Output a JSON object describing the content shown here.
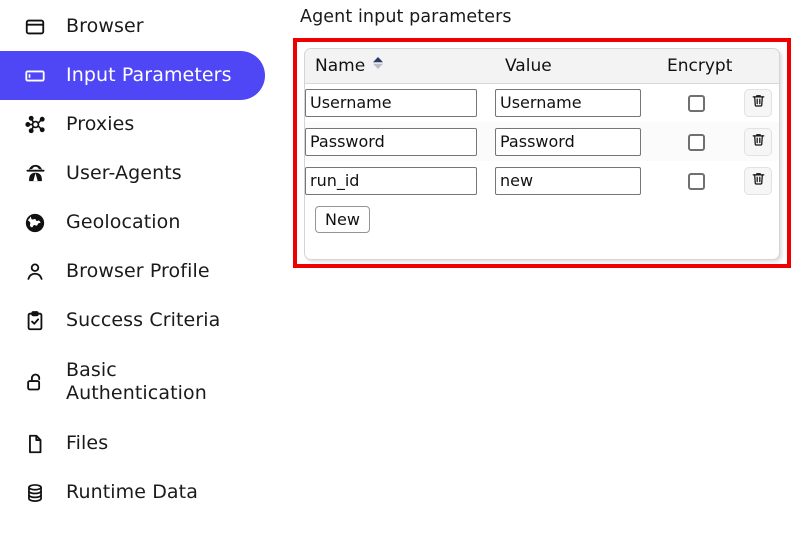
{
  "sidebar": {
    "items": [
      {
        "label": "Browser",
        "icon": "browser-window-icon",
        "active": false
      },
      {
        "label": "Input Parameters",
        "icon": "input-field-icon",
        "active": true
      },
      {
        "label": "Proxies",
        "icon": "network-nodes-icon",
        "active": false
      },
      {
        "label": "User-Agents",
        "icon": "spy-agent-icon",
        "active": false
      },
      {
        "label": "Geolocation",
        "icon": "globe-icon",
        "active": false
      },
      {
        "label": "Browser Profile",
        "icon": "user-profile-icon",
        "active": false
      },
      {
        "label": "Success Criteria",
        "icon": "clipboard-check-icon",
        "active": false
      },
      {
        "label": "Basic\nAuthentication",
        "icon": "unlocked-padlock-icon",
        "active": false
      },
      {
        "label": "Files",
        "icon": "document-icon",
        "active": false
      },
      {
        "label": "Runtime Data",
        "icon": "database-icon",
        "active": false
      }
    ],
    "active_color": "#4f46f5",
    "active_text_color": "#ffffff"
  },
  "main": {
    "title": "Agent input parameters",
    "highlight_color": "#ee0000",
    "table": {
      "columns": [
        {
          "key": "name",
          "label": "Name",
          "sortable": true,
          "sort_icon": "sort-updown-icon",
          "sort_direction": "asc"
        },
        {
          "key": "value",
          "label": "Value",
          "sortable": false
        },
        {
          "key": "encrypt",
          "label": "Encrypt",
          "sortable": false
        },
        {
          "key": "delete",
          "label": "",
          "sortable": false
        }
      ],
      "rows": [
        {
          "name": "Username",
          "value": "Username",
          "encrypt": false,
          "delete_icon": "trash-icon"
        },
        {
          "name": "Password",
          "value": "Password",
          "encrypt": false,
          "delete_icon": "trash-icon"
        },
        {
          "name": "run_id",
          "value": "new",
          "encrypt": false,
          "delete_icon": "trash-icon"
        }
      ],
      "new_button_label": "New"
    }
  }
}
